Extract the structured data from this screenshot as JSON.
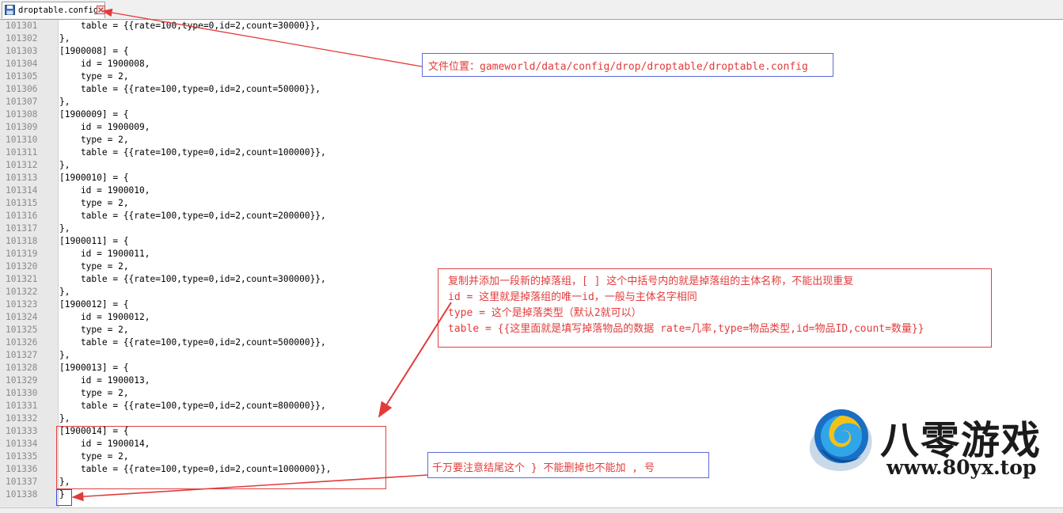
{
  "tab": {
    "icon": "save-icon",
    "label": "droptable.config",
    "close_icon": "close-icon"
  },
  "lines": [
    {
      "num": "101301",
      "text": "    table = {{rate=100,type=0,id=2,count=30000}},"
    },
    {
      "num": "101302",
      "text": "},"
    },
    {
      "num": "101303",
      "text": "[1900008] = {"
    },
    {
      "num": "101304",
      "text": "    id = 1900008,"
    },
    {
      "num": "101305",
      "text": "    type = 2,"
    },
    {
      "num": "101306",
      "text": "    table = {{rate=100,type=0,id=2,count=50000}},"
    },
    {
      "num": "101307",
      "text": "},"
    },
    {
      "num": "101308",
      "text": "[1900009] = {"
    },
    {
      "num": "101309",
      "text": "    id = 1900009,"
    },
    {
      "num": "101310",
      "text": "    type = 2,"
    },
    {
      "num": "101311",
      "text": "    table = {{rate=100,type=0,id=2,count=100000}},"
    },
    {
      "num": "101312",
      "text": "},"
    },
    {
      "num": "101313",
      "text": "[1900010] = {"
    },
    {
      "num": "101314",
      "text": "    id = 1900010,"
    },
    {
      "num": "101315",
      "text": "    type = 2,"
    },
    {
      "num": "101316",
      "text": "    table = {{rate=100,type=0,id=2,count=200000}},"
    },
    {
      "num": "101317",
      "text": "},"
    },
    {
      "num": "101318",
      "text": "[1900011] = {"
    },
    {
      "num": "101319",
      "text": "    id = 1900011,"
    },
    {
      "num": "101320",
      "text": "    type = 2,"
    },
    {
      "num": "101321",
      "text": "    table = {{rate=100,type=0,id=2,count=300000}},"
    },
    {
      "num": "101322",
      "text": "},"
    },
    {
      "num": "101323",
      "text": "[1900012] = {"
    },
    {
      "num": "101324",
      "text": "    id = 1900012,"
    },
    {
      "num": "101325",
      "text": "    type = 2,"
    },
    {
      "num": "101326",
      "text": "    table = {{rate=100,type=0,id=2,count=500000}},"
    },
    {
      "num": "101327",
      "text": "},"
    },
    {
      "num": "101328",
      "text": "[1900013] = {"
    },
    {
      "num": "101329",
      "text": "    id = 1900013,"
    },
    {
      "num": "101330",
      "text": "    type = 2,"
    },
    {
      "num": "101331",
      "text": "    table = {{rate=100,type=0,id=2,count=800000}},"
    },
    {
      "num": "101332",
      "text": "},"
    },
    {
      "num": "101333",
      "text": "[1900014] = {"
    },
    {
      "num": "101334",
      "text": "    id = 1900014,"
    },
    {
      "num": "101335",
      "text": "    type = 2,"
    },
    {
      "num": "101336",
      "text": "    table = {{rate=100,type=0,id=2,count=1000000}},"
    },
    {
      "num": "101337",
      "text": "},"
    },
    {
      "num": "101338",
      "text": "}"
    }
  ],
  "annotations": {
    "location": "文件位置：gameworld/data/config/drop/droptable/droptable.config",
    "main": [
      "复制并添加一段新的掉落组，[ ] 这个中括号内的就是掉落组的主体名称，不能出现重复",
      "id = 这里就是掉落组的唯一id，一般与主体名字相同",
      "type = 这个是掉落类型（默认2就可以）",
      "table = {{这里面就是填写掉落物品的数据 rate=几率,type=物品类型,id=物品ID,count=数量}}"
    ],
    "end_note": "千万要注意结尾这个 } 不能删掉也不能加 , 号"
  },
  "watermark": {
    "brand": "八零游戏",
    "url": "www.80yx.top"
  },
  "colors": {
    "annotation_red": "#e23b3b",
    "box_blue": "#5b6bd8",
    "gutter": "#e8e8e8"
  }
}
